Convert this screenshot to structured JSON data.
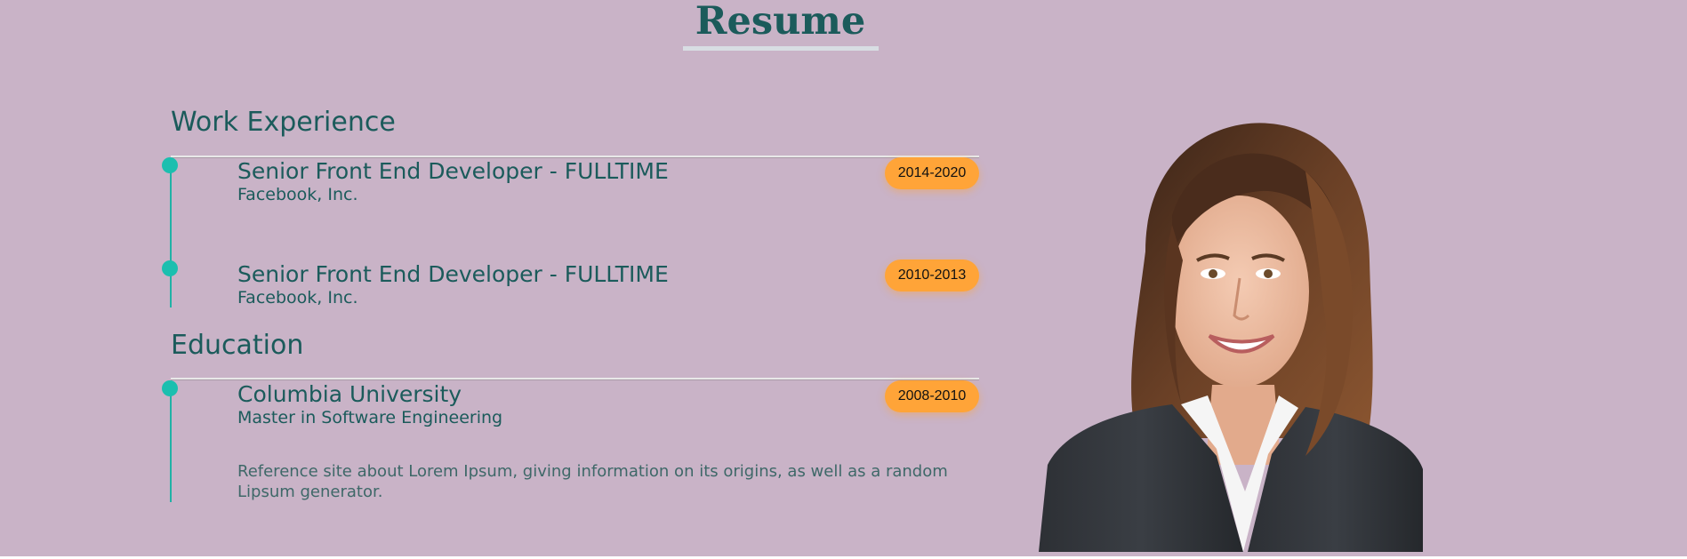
{
  "resume": {
    "title": "Resume"
  },
  "work": {
    "heading": "Work Experience",
    "items": [
      {
        "title": "Senior Front End Developer - FULLTIME",
        "company": "Facebook, Inc.",
        "years": "2014-2020"
      },
      {
        "title": "Senior Front End Developer - FULLTIME",
        "company": "Facebook, Inc.",
        "years": "2010-2013"
      }
    ]
  },
  "education": {
    "heading": "Education",
    "items": [
      {
        "school": "Columbia University",
        "degree": "Master in Software Engineering",
        "years": "2008-2010",
        "description": "Reference site about Lorem Ipsum, giving information on its origins, as well as a random Lipsum generator."
      }
    ]
  },
  "colors": {
    "background": "#c9b3c7",
    "heading": "#1b5b5b",
    "accent": "#1bbfaf",
    "badge": "#ffa438"
  },
  "icons": {
    "timeline_marker": "circle-dot"
  }
}
